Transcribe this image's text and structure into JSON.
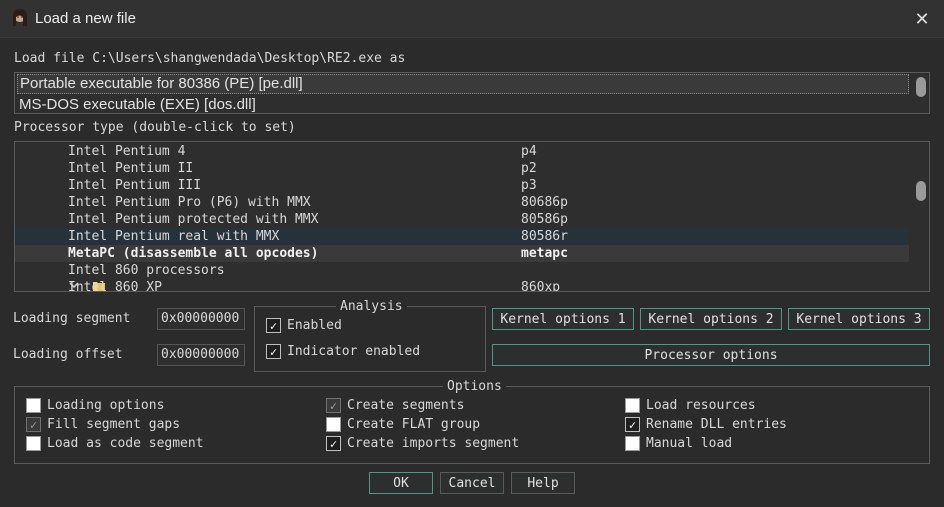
{
  "window": {
    "title": "Load a new file",
    "close_symbol": "✕"
  },
  "load_file_label": "Load file C:\\Users\\shangwendada\\Desktop\\RE2.exe as",
  "loaders": [
    {
      "label": "Portable executable for 80386 (PE) [pe.dll]",
      "selected": true
    },
    {
      "label": "MS-DOS executable (EXE) [dos.dll]",
      "selected": false
    }
  ],
  "processor_type_label": "Processor type (double-click to set)",
  "processors": [
    {
      "name": "Intel Pentium 4",
      "code": "p4"
    },
    {
      "name": "Intel Pentium II",
      "code": "p2"
    },
    {
      "name": "Intel Pentium III",
      "code": "p3"
    },
    {
      "name": "Intel Pentium Pro (P6) with MMX",
      "code": "80686p"
    },
    {
      "name": "Intel Pentium protected with MMX",
      "code": "80586p"
    },
    {
      "name": "Intel Pentium real with MMX",
      "code": "80586r"
    },
    {
      "name": "MetaPC (disassemble all opcodes)",
      "code": "metapc",
      "current": true
    },
    {
      "name": "Intel 860 processors",
      "code": "",
      "folder": true
    },
    {
      "name": "Intel 860 XP",
      "code": "860xp"
    }
  ],
  "loading_segment": {
    "label": "Loading segment",
    "value": "0x00000000"
  },
  "loading_offset": {
    "label": "Loading offset",
    "value": "0x00000000"
  },
  "analysis": {
    "title": "Analysis",
    "enabled": {
      "label": "Enabled",
      "checked": true
    },
    "indicator": {
      "label": "Indicator enabled",
      "checked": true
    }
  },
  "kernel_buttons": [
    {
      "label": "Kernel options 1"
    },
    {
      "label": "Kernel options 2"
    },
    {
      "label": "Kernel options 3"
    }
  ],
  "processor_options_label": "Processor options",
  "options": {
    "title": "Options",
    "items": [
      {
        "label": "Loading options",
        "checked": false,
        "disabled": false
      },
      {
        "label": "Fill segment gaps",
        "checked": true,
        "disabled": true
      },
      {
        "label": "Load as code segment",
        "checked": false,
        "disabled": false
      },
      {
        "label": "Create segments",
        "checked": true,
        "disabled": true
      },
      {
        "label": "Create FLAT group",
        "checked": false,
        "disabled": false
      },
      {
        "label": "Create imports segment",
        "checked": true,
        "disabled": false
      },
      {
        "label": "Load resources",
        "checked": false,
        "disabled": false
      },
      {
        "label": "Rename DLL entries",
        "checked": true,
        "disabled": false
      },
      {
        "label": "Manual load",
        "checked": false,
        "disabled": false
      }
    ]
  },
  "buttons": {
    "ok": "OK",
    "cancel": "Cancel",
    "help": "Help"
  },
  "colors": {
    "accent_border": "#4a9a8a",
    "selection": "#3a3a3a",
    "background": "#2b2b2b"
  }
}
